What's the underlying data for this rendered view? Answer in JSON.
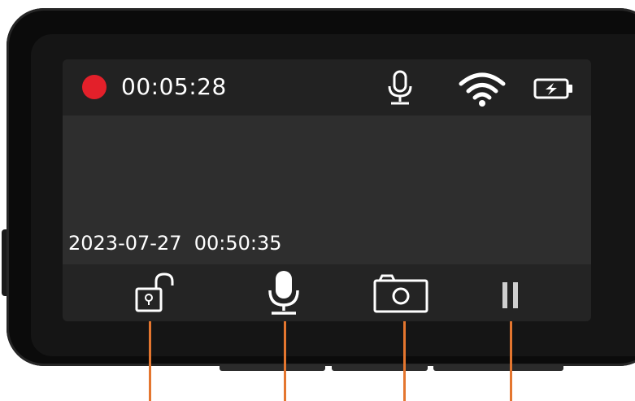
{
  "status_bar": {
    "recording_indicator_color": "#e3202a",
    "recording_time": "00:05:28",
    "icons": [
      "microphone-icon",
      "wifi-icon",
      "battery-charging-icon"
    ]
  },
  "overlay": {
    "timestamp": "2023-07-27  00:50:35"
  },
  "controls": [
    {
      "name": "lock-button",
      "icon": "unlocked-padlock-icon"
    },
    {
      "name": "microphone-button",
      "icon": "microphone-icon"
    },
    {
      "name": "snapshot-button",
      "icon": "camera-icon"
    },
    {
      "name": "pause-button",
      "icon": "pause-icon"
    }
  ],
  "colors": {
    "callout_lines": "#e4762f",
    "screen_background": "#2e2e2e",
    "device_body": "#0b0b0b"
  }
}
